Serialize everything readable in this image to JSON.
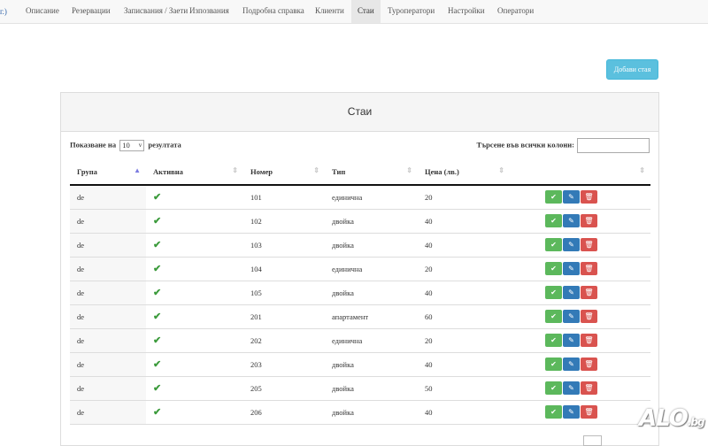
{
  "nav": {
    "brand": "г.)",
    "items": [
      {
        "label": "Описание",
        "active": false
      },
      {
        "label": "Резервации",
        "active": false
      },
      {
        "label": "Записвания / Заети",
        "active": false
      },
      {
        "label": "Изпозвания",
        "active": false
      },
      {
        "label": "Подробна справка",
        "active": false
      },
      {
        "label": "Клиенти",
        "active": false
      },
      {
        "label": "Стаи",
        "active": true
      },
      {
        "label": "Туроператори",
        "active": false
      },
      {
        "label": "Настройки",
        "active": false
      },
      {
        "label": "Оператори",
        "active": false
      }
    ]
  },
  "add_button": "Добави стая",
  "panel": {
    "title": "Стаи",
    "length_prefix": "Показване на",
    "length_value": "10",
    "length_suffix": "резултата",
    "search_label": "Търсене във всички колони:"
  },
  "table": {
    "columns": [
      "Група",
      "Активна",
      "Номер",
      "Тип",
      "Цена (лв.)",
      ""
    ],
    "check_symbol": "✔",
    "rows": [
      {
        "group": "de",
        "number": "101",
        "type": "единична",
        "price": "20"
      },
      {
        "group": "de",
        "number": "102",
        "type": "двойка",
        "price": "40"
      },
      {
        "group": "de",
        "number": "103",
        "type": "двойка",
        "price": "40"
      },
      {
        "group": "de",
        "number": "104",
        "type": "единична",
        "price": "20"
      },
      {
        "group": "de",
        "number": "105",
        "type": "двойка",
        "price": "40"
      },
      {
        "group": "de",
        "number": "201",
        "type": "апартамент",
        "price": "60"
      },
      {
        "group": "de",
        "number": "202",
        "type": "единична",
        "price": "20"
      },
      {
        "group": "de",
        "number": "203",
        "type": "двойка",
        "price": "40"
      },
      {
        "group": "de",
        "number": "205",
        "type": "двойка",
        "price": "50"
      },
      {
        "group": "de",
        "number": "206",
        "type": "двойка",
        "price": "40"
      }
    ]
  },
  "watermark": {
    "main": "ALO",
    "suffix": ".bg"
  }
}
